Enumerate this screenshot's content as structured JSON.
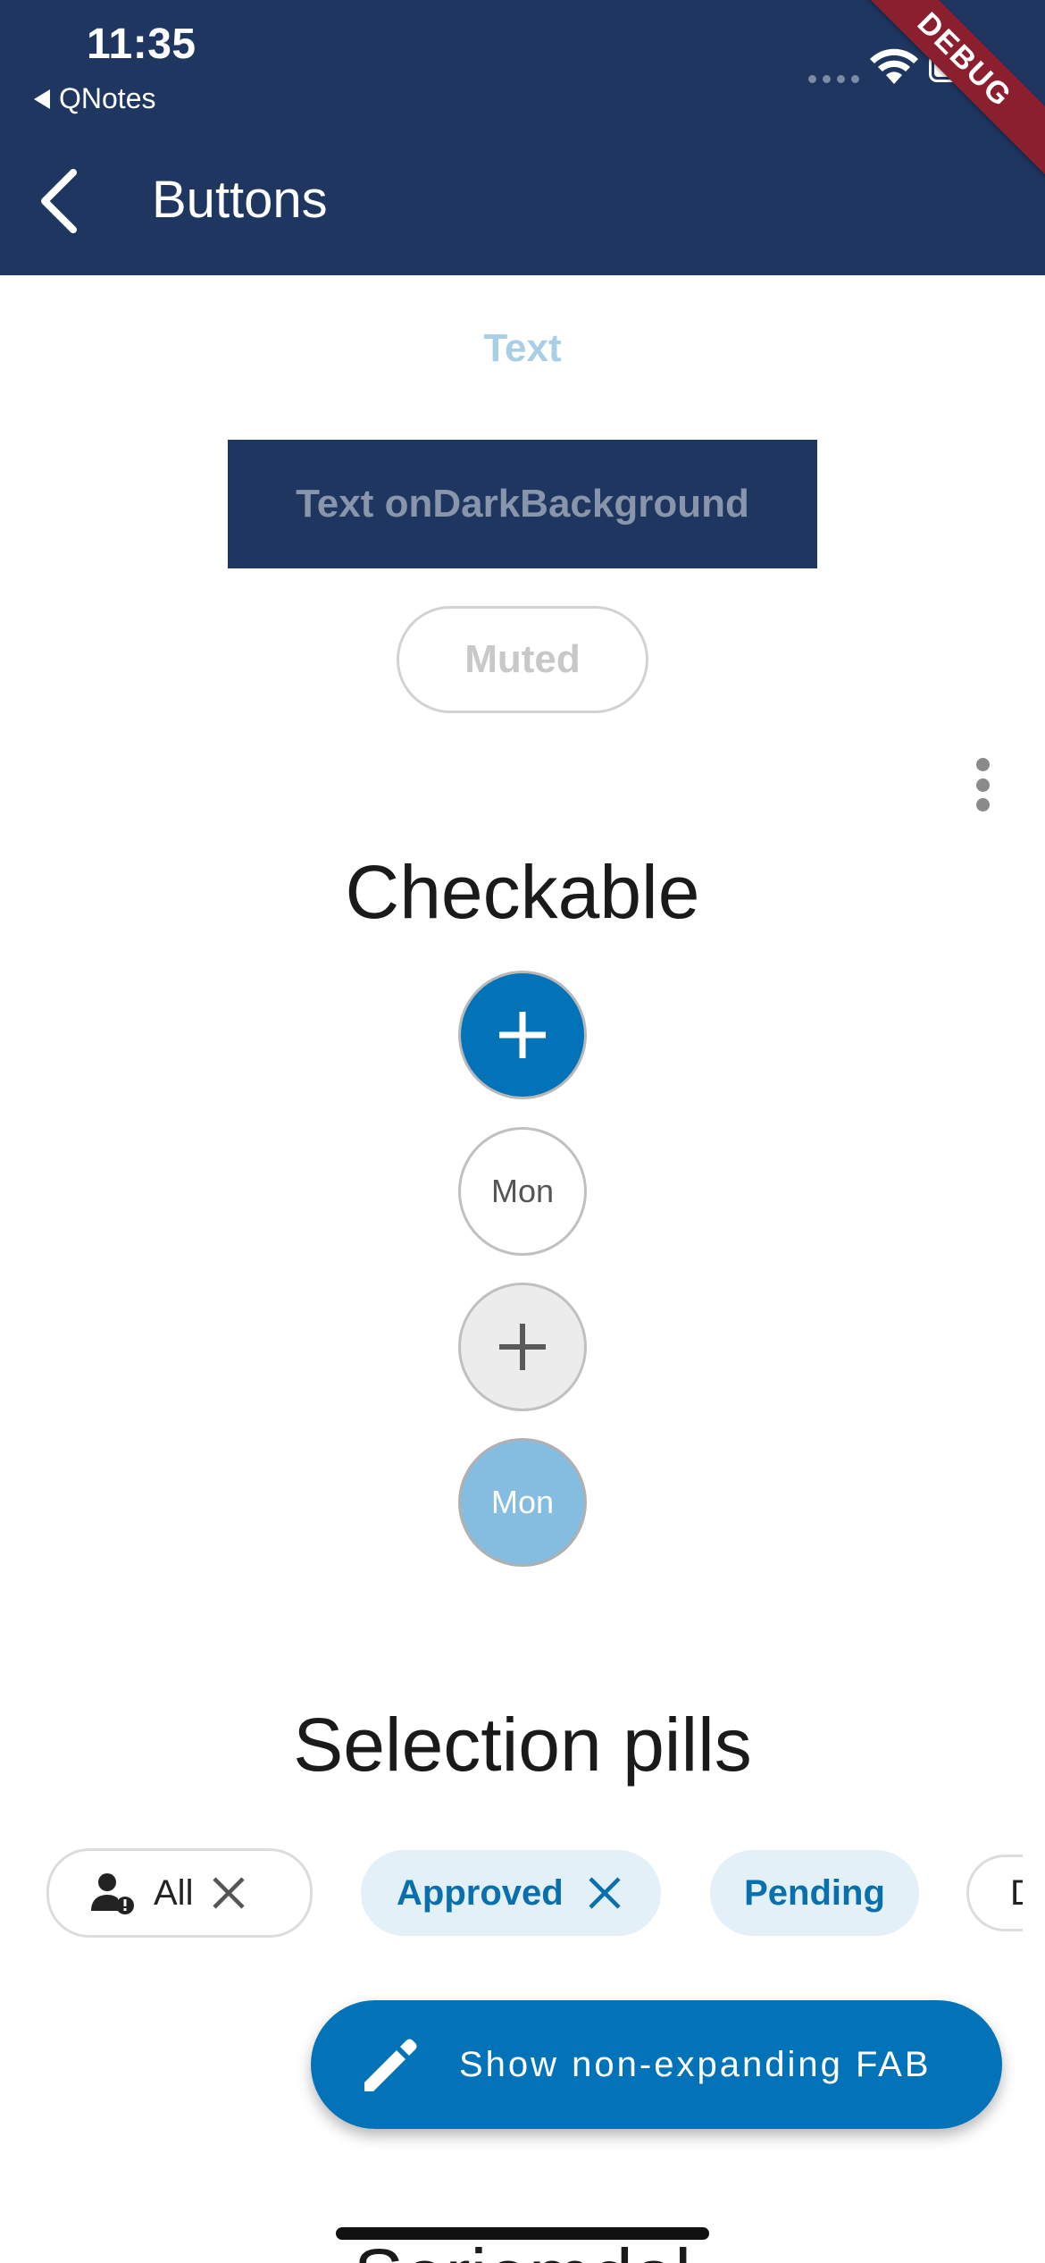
{
  "status_bar": {
    "time": "11:35",
    "back_app": "QNotes"
  },
  "app_bar": {
    "title": "Buttons",
    "debug_banner": "DEBUG",
    "background_color": "#1e3660"
  },
  "buttons": {
    "text_label": "Text",
    "dark_background_label": "Text onDarkBackground",
    "muted_label": "Muted"
  },
  "checkable": {
    "title": "Checkable",
    "items": [
      {
        "label": "",
        "icon": "plus-icon",
        "state": "selected"
      },
      {
        "label": "Mon",
        "state": "unselected"
      },
      {
        "label": "",
        "icon": "plus-icon",
        "state": "disabled"
      },
      {
        "label": "Mon",
        "state": "selected-disabled"
      }
    ]
  },
  "selection_pills": {
    "title": "Selection pills",
    "pills": [
      {
        "label": "All",
        "icon": "person-alert-icon",
        "removable": true,
        "selected": false
      },
      {
        "label": "Approved",
        "removable": true,
        "selected": true
      },
      {
        "label": "Pending",
        "removable": false,
        "selected": true
      },
      {
        "label": "D",
        "removable": false,
        "selected": false
      }
    ]
  },
  "fab": {
    "label": "Show non-expanding FAB",
    "icon": "pencil-icon"
  },
  "next_section": {
    "title": "Seriemdal"
  },
  "colors": {
    "accent": "#0373b9",
    "accent_light": "#84bde0",
    "pill_selected_bg": "#e3f0f8"
  }
}
